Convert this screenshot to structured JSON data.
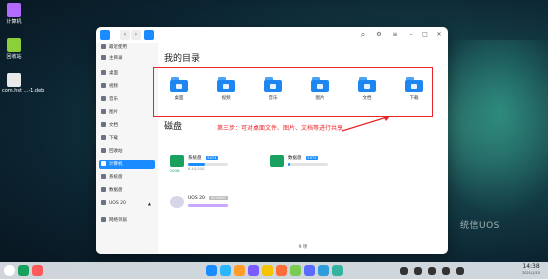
{
  "desktop": {
    "icons": [
      {
        "label": "计算机",
        "icon": "computer-icon",
        "color": "#b16cff"
      },
      {
        "label": "回收站",
        "icon": "trash-icon",
        "color": "#8ccf3a"
      },
      {
        "label": "com.hst ...-1.deb",
        "icon": "deb-package-icon",
        "color": "#e9e9e9"
      }
    ],
    "watermark": "统信UOS"
  },
  "window": {
    "nav": {
      "back": "‹",
      "forward": "›"
    },
    "sidebar": [
      {
        "label": "最近使用",
        "icon": "clock-icon"
      },
      {
        "label": "主目录",
        "icon": "home-icon"
      },
      {
        "label": "桌面",
        "icon": "desktop-icon"
      },
      {
        "label": "视频",
        "icon": "video-icon"
      },
      {
        "label": "音乐",
        "icon": "music-icon"
      },
      {
        "label": "图片",
        "icon": "picture-icon"
      },
      {
        "label": "文档",
        "icon": "document-icon"
      },
      {
        "label": "下载",
        "icon": "download-icon"
      },
      {
        "label": "回收站",
        "icon": "trash-icon"
      },
      {
        "label": "计算机",
        "icon": "computer-icon",
        "active": true
      },
      {
        "label": "系统盘",
        "icon": "disk-icon"
      },
      {
        "label": "数据盘",
        "icon": "disk-icon"
      },
      {
        "label": "UOS 20",
        "icon": "optical-disc-icon",
        "eject": "▲"
      },
      {
        "label": "网络邻居",
        "icon": "network-icon"
      }
    ],
    "my_dirs_title": "我的目录",
    "folders": [
      {
        "label": "桌面",
        "icon": "desktop-folder-icon"
      },
      {
        "label": "视频",
        "icon": "video-folder-icon"
      },
      {
        "label": "音乐",
        "icon": "music-folder-icon"
      },
      {
        "label": "图片",
        "icon": "picture-folder-icon"
      },
      {
        "label": "文档",
        "icon": "document-folder-icon"
      },
      {
        "label": "下载",
        "icon": "download-folder-icon"
      }
    ],
    "annotation": "第三步：可对桌面文件、图片、文档等进行共享",
    "disks_title": "磁盘",
    "disks": [
      {
        "name": "系统盘",
        "fs": "EXT4",
        "size": "8.4G/20G",
        "cap": "20GB",
        "used_fraction": 0.42
      },
      {
        "name": "数据盘",
        "fs": "EXT4",
        "size": "",
        "cap": "",
        "used_fraction": 0.06
      },
      {
        "name": "UOS 20",
        "fs": "ISO9660",
        "size": "",
        "cap": "",
        "used_fraction": 1.0
      }
    ],
    "status": "9 项"
  },
  "taskbar": {
    "time": "14:38",
    "date": "2021/1/15",
    "accent": "#1a8cff"
  }
}
